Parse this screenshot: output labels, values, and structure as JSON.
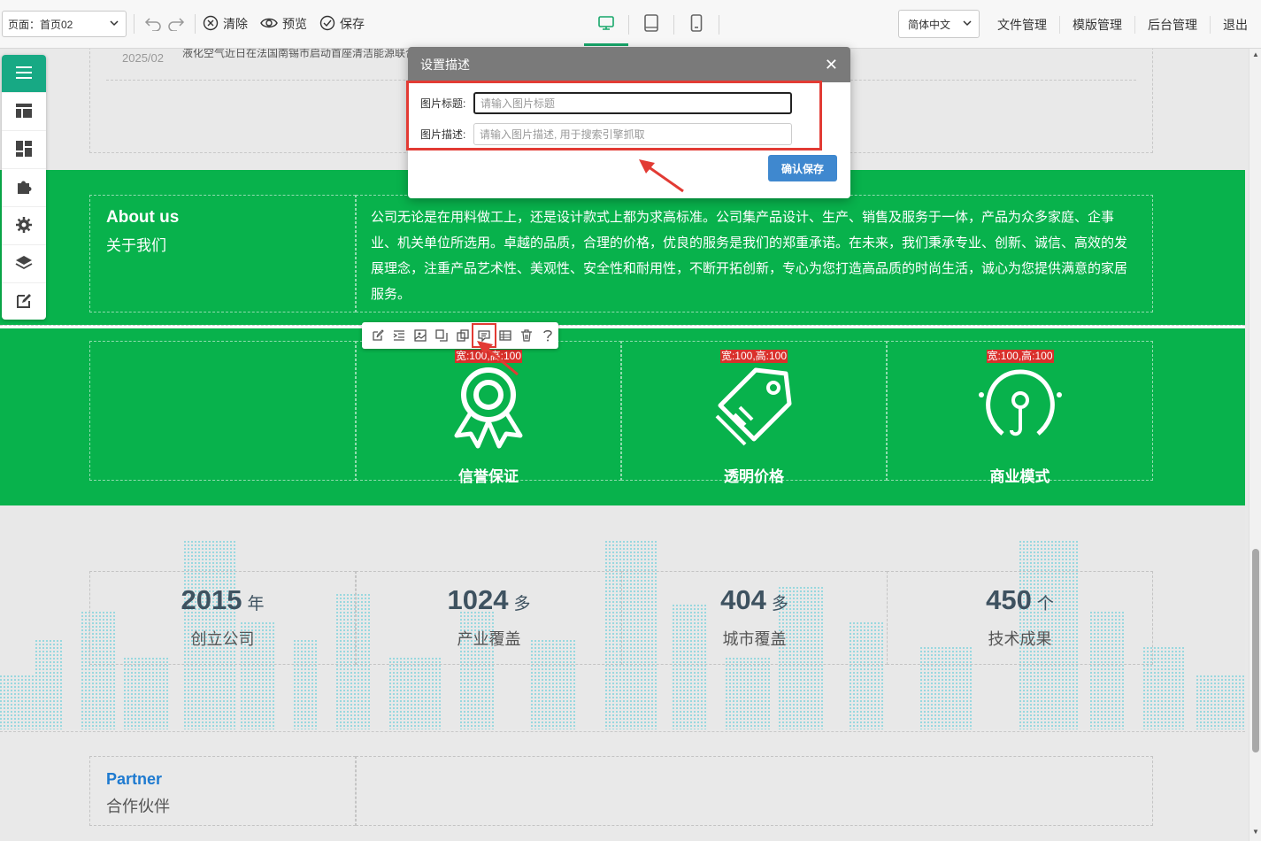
{
  "toolbar": {
    "page_select": "页面：首页02",
    "clear_label": "清除",
    "preview_label": "预览",
    "save_label": "保存",
    "language": "简体中文",
    "links": [
      "文件管理",
      "模版管理",
      "后台管理",
      "退出"
    ]
  },
  "news": {
    "date": "2025/02",
    "text": "液化空气近日在法国南锡市启动首座清洁能源联合"
  },
  "about": {
    "title_en": "About us",
    "title_cn": "关于我们",
    "body": "公司无论是在用料做工上，还是设计款式上都为求高标准。公司集产品设计、生产、销售及服务于一体，产品为众多家庭、企事业、机关单位所选用。卓越的品质，合理的价格，优良的服务是我们的郑重承诺。在未来，我们秉承专业、创新、诚信、高效的发展理念，注重产品艺术性、美观性、安全性和耐用性，不断开拓创新，专心为您打造高品质的时尚生活，诚心为您提供满意的家居服务。"
  },
  "features": [
    {
      "label": "信誉保证",
      "badge": "宽:100,高:100",
      "icon": "award-medal-icon"
    },
    {
      "label": "透明价格",
      "badge": "宽:100,高:100",
      "icon": "price-tag-icon"
    },
    {
      "label": "商业模式",
      "badge": "宽:100,高:100",
      "icon": "lightbulb-icon"
    }
  ],
  "stats": [
    {
      "number": "2015",
      "unit": "年",
      "label": "创立公司"
    },
    {
      "number": "1024",
      "unit": "多",
      "label": "产业覆盖"
    },
    {
      "number": "404",
      "unit": "多",
      "label": "城市覆盖"
    },
    {
      "number": "450",
      "unit": "个",
      "label": "技术成果"
    }
  ],
  "partner": {
    "title_en": "Partner",
    "title_cn": "合作伙伴"
  },
  "dialog": {
    "title": "设置描述",
    "title_label": "图片标题:",
    "title_placeholder": "请输入图片标题",
    "desc_label": "图片描述:",
    "desc_placeholder": "请输入图片描述, 用于搜索引擎抓取",
    "confirm_label": "确认保存"
  },
  "colors": {
    "accent_green": "#08b24c",
    "brand_teal": "#17a984",
    "annotation_red": "#e23b34",
    "confirm_blue": "#3f88cf"
  }
}
